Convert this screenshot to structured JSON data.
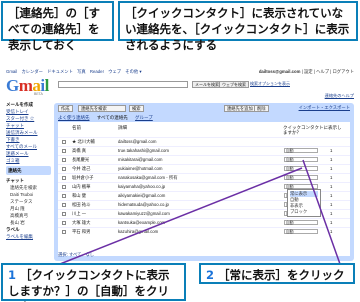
{
  "callouts": {
    "top_left": "［連絡先］の［すべての連絡先］を表示しておく",
    "top_right": "［クイックコンタクト］に表示されていない連絡先を、［クイックコンタクト］に表示されるようにする",
    "step1_num": "1",
    "step1_text": "［クイックコンタクトに表示しますか？］の［自動］をクリック",
    "step2_num": "2",
    "step2_text": "［常に表示］をクリック"
  },
  "gmail": {
    "topbar_apps": [
      "Gmail",
      "カレンダー",
      "ドキュメント",
      "写真",
      "Reader",
      "ウェブ",
      "その他 ▾"
    ],
    "account": "dailtoss@gmail.com",
    "account_links": "| 設定 | ヘルプ | ログアウト",
    "beta_label": "BETA",
    "search_mail_button": "メールを検索",
    "search_web_button": "ウェブを検索",
    "search_options_link": "検索オプションを表示",
    "right_link": "連絡先のヘルプ",
    "nav": {
      "compose": "メールを作成",
      "inbox": "受信トレイ",
      "starred": "スター付き ☆",
      "chat": "チャット",
      "sent": "送信済みメール",
      "drafts": "下書き",
      "all_mail": "すべてのメール",
      "spam": "迷惑メール",
      "trash": "ゴミ箱",
      "contacts": "連絡先",
      "chat_header": "チャット",
      "search_contacts": "連絡先を検索",
      "chat_user": "Daiti Tsuboi",
      "chat_status": "ステータス",
      "chat_contacts": [
        "月山 隆",
        "高橋真弓",
        "長山 岩"
      ],
      "labels_header": "ラベル",
      "edit_labels": "ラベルを編集"
    },
    "toolbar": {
      "compose_btn": "作成",
      "placeholder": "連絡先を検索",
      "search_btn": "検索",
      "add_btn": "連絡先を追加",
      "delete_btn": "削除",
      "import_export": "インポート・エクスポート"
    },
    "tabs": {
      "frequent": "よく使う連絡先",
      "all": "すべての連絡先",
      "groups": "グループ"
    },
    "columns": {
      "name": "名前",
      "detail": "詳細",
      "quick": "クイックコンタクトに表示しますか？"
    },
    "contacts": [
      {
        "name": "★ 北川大輔",
        "email": "dailtoss@gmail.com",
        "quick": "",
        "count": ""
      },
      {
        "name": "高橋 真",
        "email": "true.takahashi@gmail.com",
        "quick": "自動",
        "count": "1"
      },
      {
        "name": "長尾慶光",
        "email": "misakitarai@gmail.com",
        "quick": "自動",
        "count": "1"
      },
      {
        "name": "今井 達己",
        "email": "yukiaime@hotmail.com",
        "quick": "自動",
        "count": "1"
      },
      {
        "name": "坂井倉小子",
        "email": "nanakosaka@gmail.com - 所有",
        "quick": "自動",
        "count": "1"
      },
      {
        "name": "山内 楓華",
        "email": "kaiyamaha@yahoo.co.jp",
        "quick": "自動",
        "count": "1"
      },
      {
        "name": "和山 健",
        "email": "aikiyamakiei@gmail.com",
        "quick": "自動",
        "count": "1"
      },
      {
        "name": "松田 祐斗",
        "email": "hidematsuda@yahoo.co.jp",
        "quick": "自動",
        "count": "1"
      },
      {
        "name": "川上 一",
        "email": "kawakamiyuzz@gmail.com",
        "quick": "自動",
        "count": "1"
      },
      {
        "name": "大塚 雄大",
        "email": "kantsuka@example.com",
        "quick": "自動",
        "count": "1"
      },
      {
        "name": "平石 和男",
        "email": "kazuhira@gmail.com",
        "quick": "自動",
        "count": "1"
      }
    ],
    "dropdown": [
      "常に表示",
      "自動",
      "非表示",
      "ブロック"
    ],
    "footer": "選択: すべて、なし"
  }
}
